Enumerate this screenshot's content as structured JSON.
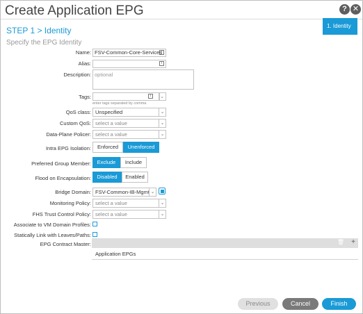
{
  "dialog": {
    "title": "Create Application EPG",
    "help_glyph": "?",
    "close_glyph": "✕"
  },
  "step": {
    "title": "STEP 1 > Identity",
    "sidebar_item": "1. Identity"
  },
  "section": {
    "title": "Specify the EPG Identity"
  },
  "form": {
    "name": {
      "label": "Name:",
      "value": "FSV-Common-Core-Services"
    },
    "alias": {
      "label": "Alias:",
      "value": ""
    },
    "description": {
      "label": "Description:",
      "placeholder": "optional"
    },
    "tags": {
      "label": "Tags:",
      "value": "",
      "hint": "enter tags separated by comma"
    },
    "qos_class": {
      "label": "QoS class:",
      "value": "Unspecified"
    },
    "custom_qos": {
      "label": "Custom QoS:",
      "value": "select a value"
    },
    "data_plane_policer": {
      "label": "Data-Plane Policer:",
      "value": "select a value"
    },
    "intra_epg_isolation": {
      "label": "Intra EPG Isolation:",
      "options": [
        "Enforced",
        "Unenforced"
      ],
      "selected": "Unenforced"
    },
    "preferred_group_member": {
      "label": "Preferred Group Member:",
      "options": [
        "Exclude",
        "Include"
      ],
      "selected": "Exclude"
    },
    "flood_on_encapsulation": {
      "label": "Flood on Encapsulation:",
      "options": [
        "Disabled",
        "Enabled"
      ],
      "selected": "Disabled"
    },
    "bridge_domain": {
      "label": "Bridge Domain:",
      "value": "FSV-Common-IB-Mgmt"
    },
    "monitoring_policy": {
      "label": "Monitoring Policy:",
      "value": "select a value"
    },
    "fhs_trust_control_policy": {
      "label": "FHS Trust Control Policy:",
      "value": "select a value"
    },
    "associate_vm_domain": {
      "label": "Associate to VM Domain Profiles:",
      "checked": false
    },
    "statically_link": {
      "label": "Statically Link with Leaves/Paths:",
      "checked": false
    },
    "epg_contract_master": {
      "label": "EPG Contract Master:",
      "column": "Application EPGs",
      "add_glyph": "+",
      "delete_glyph": "🗑"
    }
  },
  "footer": {
    "previous": "Previous",
    "cancel": "Cancel",
    "finish": "Finish"
  },
  "colors": {
    "accent": "#1a9ad6",
    "disabled_button": "#e0e0e0",
    "cancel_button": "#7a7a7a"
  }
}
